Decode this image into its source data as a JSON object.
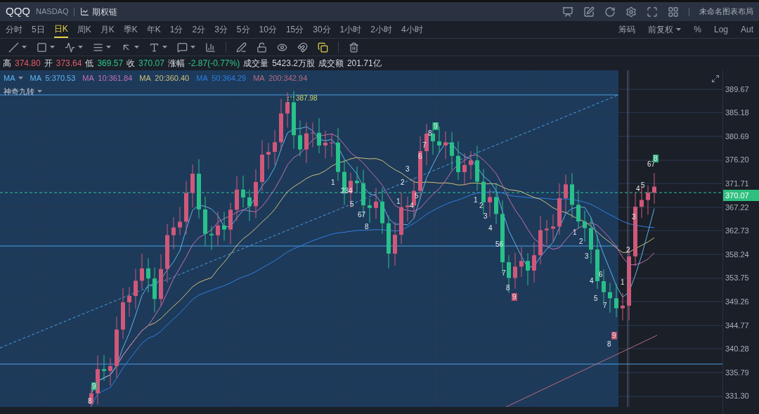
{
  "header": {
    "symbol": "QQQ",
    "exchange": "NASDAQ",
    "option_chain": "期权链",
    "layout_name": "未命名图表布局"
  },
  "periods": [
    {
      "label": "分时",
      "selected": false
    },
    {
      "label": "5日",
      "selected": false
    },
    {
      "label": "日K",
      "selected": true
    },
    {
      "label": "周K",
      "selected": false
    },
    {
      "label": "月K",
      "selected": false
    },
    {
      "label": "季K",
      "selected": false
    },
    {
      "label": "年K",
      "selected": false
    },
    {
      "label": "1分",
      "selected": false
    },
    {
      "label": "2分",
      "selected": false
    },
    {
      "label": "3分",
      "selected": false
    },
    {
      "label": "5分",
      "selected": false
    },
    {
      "label": "10分",
      "selected": false
    },
    {
      "label": "15分",
      "selected": false
    },
    {
      "label": "30分",
      "selected": false
    },
    {
      "label": "1小时",
      "selected": false
    },
    {
      "label": "2小时",
      "selected": false
    },
    {
      "label": "4小时",
      "selected": false
    }
  ],
  "chart_options": [
    {
      "label": "筹码",
      "kind": "plain"
    },
    {
      "label": "前复权",
      "kind": "dropdown"
    },
    {
      "label": "%",
      "kind": "plain"
    },
    {
      "label": "Log",
      "kind": "plain"
    },
    {
      "label": "Aut",
      "kind": "plain"
    }
  ],
  "quote": [
    {
      "label": "高",
      "value": "374.80",
      "color": "#e25a6a"
    },
    {
      "label": "开",
      "value": "373.64",
      "color": "#e25a6a"
    },
    {
      "label": "低",
      "value": "369.57",
      "color": "#2fc48a"
    },
    {
      "label": "收",
      "value": "370.07",
      "color": "#2fc48a"
    },
    {
      "label": "涨幅",
      "value": "-2.87(-0.77%)",
      "color": "#2fc48a"
    },
    {
      "label": "成交量",
      "value": "5423.2万股",
      "color": "#d5d9e0"
    },
    {
      "label": "成交额",
      "value": "201.71亿",
      "color": "#d5d9e0"
    }
  ],
  "ma_legend": {
    "label": "MA",
    "lines": [
      {
        "text": "MA  5:370.53",
        "color": "#5fb4ec"
      },
      {
        "text": "MA  10:361.84",
        "color": "#c46fb4"
      },
      {
        "text": "MA  20:360.40",
        "color": "#cdbf7a"
      },
      {
        "text": "MA  50:364.29",
        "color": "#2f7ee0"
      },
      {
        "text": "MA  200:342.94",
        "color": "#b86a80"
      }
    ]
  },
  "indicator": "神奇九转",
  "high_marker": "387.98",
  "td_marks": [
    {
      "label": "8",
      "kind": "plain"
    },
    {
      "label": "9",
      "kind": "sell"
    },
    {
      "label": "1",
      "kind": "plain"
    },
    {
      "label": "234",
      "kind": "plain"
    },
    {
      "label": "5",
      "kind": "plain"
    },
    {
      "label": "67",
      "kind": "plain"
    },
    {
      "label": "8",
      "kind": "plain"
    },
    {
      "label": "1",
      "kind": "plain"
    },
    {
      "label": "2",
      "kind": "plain"
    },
    {
      "label": "3",
      "kind": "plain"
    },
    {
      "label": "4",
      "kind": "plain"
    },
    {
      "label": "5",
      "kind": "plain"
    },
    {
      "label": "6",
      "kind": "plain"
    },
    {
      "label": "7",
      "kind": "plain"
    },
    {
      "label": "8",
      "kind": "plain"
    },
    {
      "label": "9",
      "kind": "sell"
    },
    {
      "label": "1",
      "kind": "plain"
    },
    {
      "label": "2",
      "kind": "plain"
    },
    {
      "label": "3",
      "kind": "plain"
    },
    {
      "label": "4",
      "kind": "plain"
    },
    {
      "label": "56",
      "kind": "plain"
    },
    {
      "label": "7",
      "kind": "plain"
    },
    {
      "label": "8",
      "kind": "plain"
    },
    {
      "label": "9",
      "kind": "buy"
    },
    {
      "label": "1",
      "kind": "plain"
    },
    {
      "label": "2",
      "kind": "plain"
    },
    {
      "label": "3",
      "kind": "plain"
    },
    {
      "label": "4",
      "kind": "plain"
    },
    {
      "label": "5",
      "kind": "plain"
    },
    {
      "label": "6",
      "kind": "plain"
    },
    {
      "label": "7",
      "kind": "plain"
    },
    {
      "label": "8",
      "kind": "plain"
    },
    {
      "label": "9",
      "kind": "buy"
    },
    {
      "label": "1",
      "kind": "plain"
    },
    {
      "label": "2",
      "kind": "plain"
    },
    {
      "label": "3",
      "kind": "plain"
    },
    {
      "label": "4",
      "kind": "plain"
    },
    {
      "label": "5",
      "kind": "plain"
    },
    {
      "label": "67",
      "kind": "plain"
    },
    {
      "label": "8",
      "kind": "sell"
    }
  ],
  "price_axis": [
    "389.67",
    "385.18",
    "380.69",
    "376.20",
    "371.71",
    "367.22",
    "362.73",
    "358.24",
    "353.75",
    "349.26",
    "344.77",
    "340.28",
    "335.79",
    "331.30"
  ],
  "last_price": "370.07"
}
